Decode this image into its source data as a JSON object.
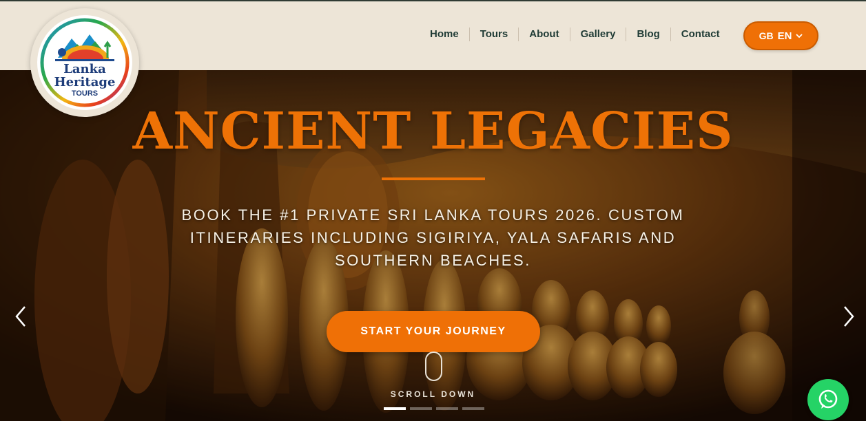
{
  "brand": {
    "line1": "Lanka",
    "line2": "Heritage",
    "line3": "TOURS"
  },
  "nav": {
    "items": [
      {
        "label": "Home"
      },
      {
        "label": "Tours"
      },
      {
        "label": "About"
      },
      {
        "label": "Gallery"
      },
      {
        "label": "Blog"
      },
      {
        "label": "Contact"
      }
    ]
  },
  "language": {
    "flag": "GB",
    "code": "EN",
    "icon": "chevron-down-icon"
  },
  "hero": {
    "title": "ANCIENT LEGACIES",
    "subtitle": "BOOK THE #1 PRIVATE SRI LANKA TOURS 2026. CUSTOM ITINERARIES INCLUDING SIGIRIYA, YALA SAFARIS AND SOUTHERN BEACHES.",
    "cta_label": "START YOUR JOURNEY",
    "scroll_label": "SCROLL DOWN",
    "slides_count": 4,
    "active_slide": 1
  },
  "colors": {
    "accent": "#ef7006",
    "header_bg": "#ede5d7",
    "nav_text": "#1f3b35",
    "whatsapp": "#25d366"
  },
  "icons": {
    "prev": "chevron-left-icon",
    "next": "chevron-right-icon",
    "whatsapp": "whatsapp-icon",
    "mouse": "mouse-icon"
  }
}
